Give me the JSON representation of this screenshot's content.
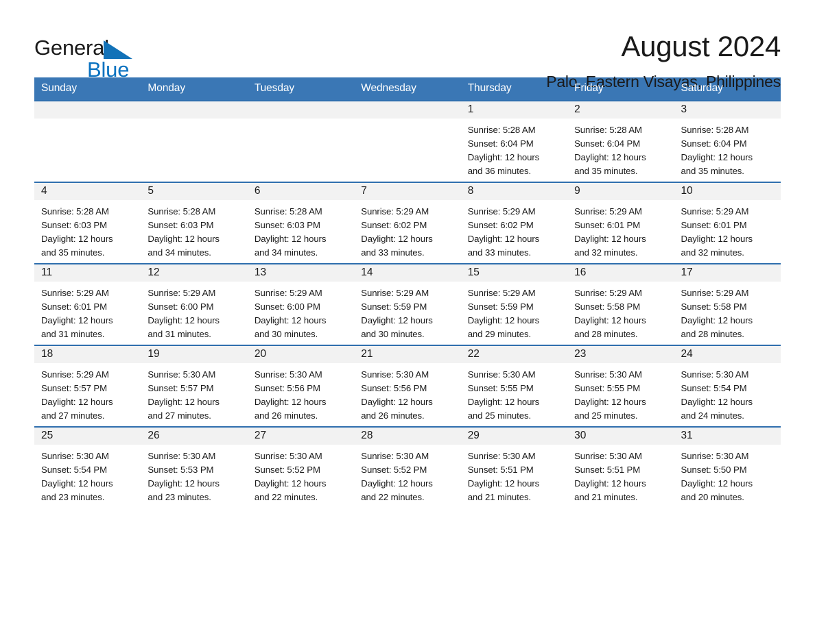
{
  "logo": {
    "word_one": "General",
    "word_two": "Blue",
    "triangle_color": "#1272b8",
    "blue_color": "#0a72c0"
  },
  "header": {
    "title": "August 2024",
    "subtitle": "Palo, Eastern Visayas, Philippines"
  },
  "calendar": {
    "header_background": "#3a77b5",
    "header_text_color": "#ffffff",
    "daynum_background": "#f2f2f2",
    "row_border_color": "#2f6fae",
    "weekdays": [
      "Sunday",
      "Monday",
      "Tuesday",
      "Wednesday",
      "Thursday",
      "Friday",
      "Saturday"
    ],
    "weeks": [
      [
        {
          "day": "",
          "blank": true
        },
        {
          "day": "",
          "blank": true
        },
        {
          "day": "",
          "blank": true
        },
        {
          "day": "",
          "blank": true
        },
        {
          "day": "1",
          "sunrise": "Sunrise: 5:28 AM",
          "sunset": "Sunset: 6:04 PM",
          "daylight_line1": "Daylight: 12 hours",
          "daylight_line2": "and 36 minutes."
        },
        {
          "day": "2",
          "sunrise": "Sunrise: 5:28 AM",
          "sunset": "Sunset: 6:04 PM",
          "daylight_line1": "Daylight: 12 hours",
          "daylight_line2": "and 35 minutes."
        },
        {
          "day": "3",
          "sunrise": "Sunrise: 5:28 AM",
          "sunset": "Sunset: 6:04 PM",
          "daylight_line1": "Daylight: 12 hours",
          "daylight_line2": "and 35 minutes."
        }
      ],
      [
        {
          "day": "4",
          "sunrise": "Sunrise: 5:28 AM",
          "sunset": "Sunset: 6:03 PM",
          "daylight_line1": "Daylight: 12 hours",
          "daylight_line2": "and 35 minutes."
        },
        {
          "day": "5",
          "sunrise": "Sunrise: 5:28 AM",
          "sunset": "Sunset: 6:03 PM",
          "daylight_line1": "Daylight: 12 hours",
          "daylight_line2": "and 34 minutes."
        },
        {
          "day": "6",
          "sunrise": "Sunrise: 5:28 AM",
          "sunset": "Sunset: 6:03 PM",
          "daylight_line1": "Daylight: 12 hours",
          "daylight_line2": "and 34 minutes."
        },
        {
          "day": "7",
          "sunrise": "Sunrise: 5:29 AM",
          "sunset": "Sunset: 6:02 PM",
          "daylight_line1": "Daylight: 12 hours",
          "daylight_line2": "and 33 minutes."
        },
        {
          "day": "8",
          "sunrise": "Sunrise: 5:29 AM",
          "sunset": "Sunset: 6:02 PM",
          "daylight_line1": "Daylight: 12 hours",
          "daylight_line2": "and 33 minutes."
        },
        {
          "day": "9",
          "sunrise": "Sunrise: 5:29 AM",
          "sunset": "Sunset: 6:01 PM",
          "daylight_line1": "Daylight: 12 hours",
          "daylight_line2": "and 32 minutes."
        },
        {
          "day": "10",
          "sunrise": "Sunrise: 5:29 AM",
          "sunset": "Sunset: 6:01 PM",
          "daylight_line1": "Daylight: 12 hours",
          "daylight_line2": "and 32 minutes."
        }
      ],
      [
        {
          "day": "11",
          "sunrise": "Sunrise: 5:29 AM",
          "sunset": "Sunset: 6:01 PM",
          "daylight_line1": "Daylight: 12 hours",
          "daylight_line2": "and 31 minutes."
        },
        {
          "day": "12",
          "sunrise": "Sunrise: 5:29 AM",
          "sunset": "Sunset: 6:00 PM",
          "daylight_line1": "Daylight: 12 hours",
          "daylight_line2": "and 31 minutes."
        },
        {
          "day": "13",
          "sunrise": "Sunrise: 5:29 AM",
          "sunset": "Sunset: 6:00 PM",
          "daylight_line1": "Daylight: 12 hours",
          "daylight_line2": "and 30 minutes."
        },
        {
          "day": "14",
          "sunrise": "Sunrise: 5:29 AM",
          "sunset": "Sunset: 5:59 PM",
          "daylight_line1": "Daylight: 12 hours",
          "daylight_line2": "and 30 minutes."
        },
        {
          "day": "15",
          "sunrise": "Sunrise: 5:29 AM",
          "sunset": "Sunset: 5:59 PM",
          "daylight_line1": "Daylight: 12 hours",
          "daylight_line2": "and 29 minutes."
        },
        {
          "day": "16",
          "sunrise": "Sunrise: 5:29 AM",
          "sunset": "Sunset: 5:58 PM",
          "daylight_line1": "Daylight: 12 hours",
          "daylight_line2": "and 28 minutes."
        },
        {
          "day": "17",
          "sunrise": "Sunrise: 5:29 AM",
          "sunset": "Sunset: 5:58 PM",
          "daylight_line1": "Daylight: 12 hours",
          "daylight_line2": "and 28 minutes."
        }
      ],
      [
        {
          "day": "18",
          "sunrise": "Sunrise: 5:29 AM",
          "sunset": "Sunset: 5:57 PM",
          "daylight_line1": "Daylight: 12 hours",
          "daylight_line2": "and 27 minutes."
        },
        {
          "day": "19",
          "sunrise": "Sunrise: 5:30 AM",
          "sunset": "Sunset: 5:57 PM",
          "daylight_line1": "Daylight: 12 hours",
          "daylight_line2": "and 27 minutes."
        },
        {
          "day": "20",
          "sunrise": "Sunrise: 5:30 AM",
          "sunset": "Sunset: 5:56 PM",
          "daylight_line1": "Daylight: 12 hours",
          "daylight_line2": "and 26 minutes."
        },
        {
          "day": "21",
          "sunrise": "Sunrise: 5:30 AM",
          "sunset": "Sunset: 5:56 PM",
          "daylight_line1": "Daylight: 12 hours",
          "daylight_line2": "and 26 minutes."
        },
        {
          "day": "22",
          "sunrise": "Sunrise: 5:30 AM",
          "sunset": "Sunset: 5:55 PM",
          "daylight_line1": "Daylight: 12 hours",
          "daylight_line2": "and 25 minutes."
        },
        {
          "day": "23",
          "sunrise": "Sunrise: 5:30 AM",
          "sunset": "Sunset: 5:55 PM",
          "daylight_line1": "Daylight: 12 hours",
          "daylight_line2": "and 25 minutes."
        },
        {
          "day": "24",
          "sunrise": "Sunrise: 5:30 AM",
          "sunset": "Sunset: 5:54 PM",
          "daylight_line1": "Daylight: 12 hours",
          "daylight_line2": "and 24 minutes."
        }
      ],
      [
        {
          "day": "25",
          "sunrise": "Sunrise: 5:30 AM",
          "sunset": "Sunset: 5:54 PM",
          "daylight_line1": "Daylight: 12 hours",
          "daylight_line2": "and 23 minutes."
        },
        {
          "day": "26",
          "sunrise": "Sunrise: 5:30 AM",
          "sunset": "Sunset: 5:53 PM",
          "daylight_line1": "Daylight: 12 hours",
          "daylight_line2": "and 23 minutes."
        },
        {
          "day": "27",
          "sunrise": "Sunrise: 5:30 AM",
          "sunset": "Sunset: 5:52 PM",
          "daylight_line1": "Daylight: 12 hours",
          "daylight_line2": "and 22 minutes."
        },
        {
          "day": "28",
          "sunrise": "Sunrise: 5:30 AM",
          "sunset": "Sunset: 5:52 PM",
          "daylight_line1": "Daylight: 12 hours",
          "daylight_line2": "and 22 minutes."
        },
        {
          "day": "29",
          "sunrise": "Sunrise: 5:30 AM",
          "sunset": "Sunset: 5:51 PM",
          "daylight_line1": "Daylight: 12 hours",
          "daylight_line2": "and 21 minutes."
        },
        {
          "day": "30",
          "sunrise": "Sunrise: 5:30 AM",
          "sunset": "Sunset: 5:51 PM",
          "daylight_line1": "Daylight: 12 hours",
          "daylight_line2": "and 21 minutes."
        },
        {
          "day": "31",
          "sunrise": "Sunrise: 5:30 AM",
          "sunset": "Sunset: 5:50 PM",
          "daylight_line1": "Daylight: 12 hours",
          "daylight_line2": "and 20 minutes."
        }
      ]
    ]
  }
}
